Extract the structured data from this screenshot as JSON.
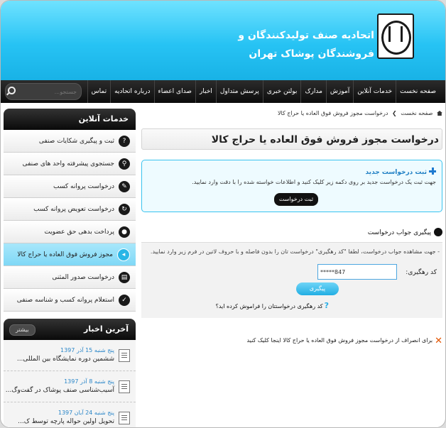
{
  "header": {
    "title_line1": "اتحادیه صنف تولیدکنندگان و",
    "title_line2": "فروشندگان پوشاک تهران",
    "logo": "guild-logo"
  },
  "nav": {
    "items": [
      "صفحه نخست",
      "خدمات آنلاین",
      "آموزش",
      "مدارک",
      "بولتن خبری",
      "پرسش متداول",
      "اخبار",
      "صدای اعضاء",
      "درباره اتحادیه",
      "تماس"
    ],
    "search_placeholder": "جستجو..."
  },
  "sidebar": {
    "services_title": "خدمات آنلاین",
    "services": [
      {
        "label": "ثبت و پیگیری شکایات صنفی",
        "icon": "question-icon"
      },
      {
        "label": "جستجوی پیشرفته واحد های صنفی",
        "icon": "search-icon"
      },
      {
        "label": "درخواست پروانه کسب",
        "icon": "pencil-icon"
      },
      {
        "label": "درخواست تعویض پروانه کسب",
        "icon": "refresh-icon"
      },
      {
        "label": "پرداخت بدهی حق عضویت",
        "icon": "users-icon"
      },
      {
        "label": "مجوز فروش فوق العاده یا حراج کالا",
        "icon": "speaker-icon"
      },
      {
        "label": "درخواست صدور المثنی",
        "icon": "document-icon"
      },
      {
        "label": "استعلام پروانه کسب و شناسه صنفی",
        "icon": "check-icon"
      }
    ],
    "news_title": "آخرین اخبار",
    "news_more": "بیشتر",
    "news": [
      {
        "date": "پنج شنبه 15 آذر 1397",
        "title": "ششمین دوره نمایشگاه بین المللی..."
      },
      {
        "date": "پنج شنبه 8 آذر 1397",
        "title": "آسیب‌شناسی صنف پوشاک در گفت‌وگ..."
      },
      {
        "date": "پنج شنبه 24 آبان 1397",
        "title": "تحویل اولین حواله پارچه توسط ک..."
      }
    ]
  },
  "breadcrumb": {
    "home": "صفحه نخست",
    "separator": "❯",
    "current": "درخواست مجوز فروش فوق العاده یا حراج کالا"
  },
  "main": {
    "page_title": "درخواست مجوز فروش فوق العاده یا حراج کالا",
    "new_request_heading": "ثبت درخواست جدید",
    "new_request_desc": "جهت ثبت یک درخواست جدید بر روی دکمه زیر کلیک کنید و اطلاعات خواسته شده را با دقت وارد نمایید.",
    "new_request_button": "ثبت درخواست",
    "track_heading": "پیگیری جواب درخواست",
    "track_desc": "- جهت مشاهده جواب درخواست، لطفا \"کد رهگیری\" درخواست تان را بدون فاصله و با حروف لاتین در فرم زیر وارد نمایید.",
    "code_label": "کد رهگیری:",
    "code_value": "*****847",
    "track_button": "پیگیری",
    "forgot_text": "کد رهگیری درخواستتان را فراموش کرده اید؟",
    "cancel_text": "برای انصراف از درخواست مجوز فروش فوق العاده یا حراج کالا اینجا کلیک کنید"
  },
  "colors": {
    "accent": "#29b6e6",
    "header": "#27c3f4",
    "nav": "#111111",
    "cancel": "#e35400"
  }
}
